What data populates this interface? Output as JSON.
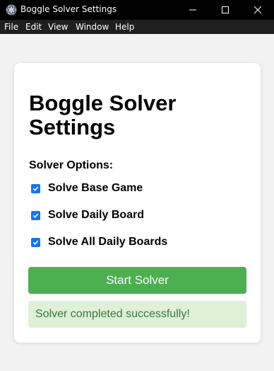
{
  "window": {
    "title": "Boggle Solver Settings",
    "icon": "app-logo-icon"
  },
  "menu": {
    "items": [
      {
        "label": "File"
      },
      {
        "label": "Edit"
      },
      {
        "label": "View"
      },
      {
        "label": "Window"
      },
      {
        "label": "Help"
      }
    ]
  },
  "settings": {
    "title": "Boggle Solver Settings",
    "section_label": "Solver Options:",
    "options": [
      {
        "label": "Solve Base Game",
        "checked": true
      },
      {
        "label": "Solve Daily Board",
        "checked": true
      },
      {
        "label": "Solve All Daily Boards",
        "checked": true
      }
    ],
    "start_button": "Start Solver",
    "status": "Solver completed successfully!"
  },
  "colors": {
    "titlebar": "#000000",
    "menubar": "#1f1f1f",
    "checkbox": "#1a73e8",
    "start_button": "#4caf50",
    "status_bg": "#dff0d8",
    "status_text": "#3c763d"
  }
}
